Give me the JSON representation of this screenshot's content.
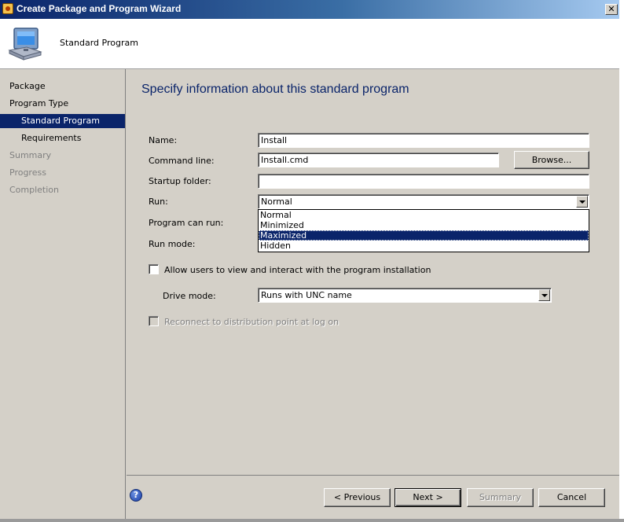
{
  "window": {
    "title": "Create Package and Program Wizard",
    "close_glyph": "✕"
  },
  "header": {
    "title": "Standard Program",
    "icon": "computer-icon"
  },
  "nav": {
    "items": [
      {
        "label": "Package",
        "state": "normal"
      },
      {
        "label": "Program Type",
        "state": "normal"
      },
      {
        "label": "Standard Program",
        "state": "selected"
      },
      {
        "label": "Requirements",
        "state": "normal"
      },
      {
        "label": "Summary",
        "state": "disabled"
      },
      {
        "label": "Progress",
        "state": "disabled"
      },
      {
        "label": "Completion",
        "state": "disabled"
      }
    ]
  },
  "content": {
    "title": "Specify information about this standard program",
    "name_label": "Name:",
    "name_value": "Install",
    "command_line_label": "Command line:",
    "command_line_value": "Install.cmd",
    "browse_label": "Browse...",
    "startup_folder_label": "Startup folder:",
    "startup_folder_value": "",
    "run_label": "Run:",
    "run_value": "Normal",
    "run_options": [
      "Normal",
      "Minimized",
      "Maximized",
      "Hidden"
    ],
    "run_highlighted": "Maximized",
    "program_can_run_label": "Program can run:",
    "run_mode_label": "Run mode:",
    "allow_users_label": "Allow users to view and interact with the program installation",
    "allow_users_checked": false,
    "drive_mode_label": "Drive mode:",
    "drive_mode_value": "Runs with UNC name",
    "reconnect_label": "Reconnect to distribution point at log on",
    "reconnect_checked": false
  },
  "footer": {
    "help_icon": "help-icon",
    "help_glyph": "?",
    "previous_label": "< Previous",
    "next_label": "Next >",
    "summary_label": "Summary",
    "cancel_label": "Cancel"
  },
  "colors": {
    "title_bar": "#0a246a",
    "face": "#d4d0c8",
    "selection": "#0a246a",
    "heading": "#0a246a"
  }
}
